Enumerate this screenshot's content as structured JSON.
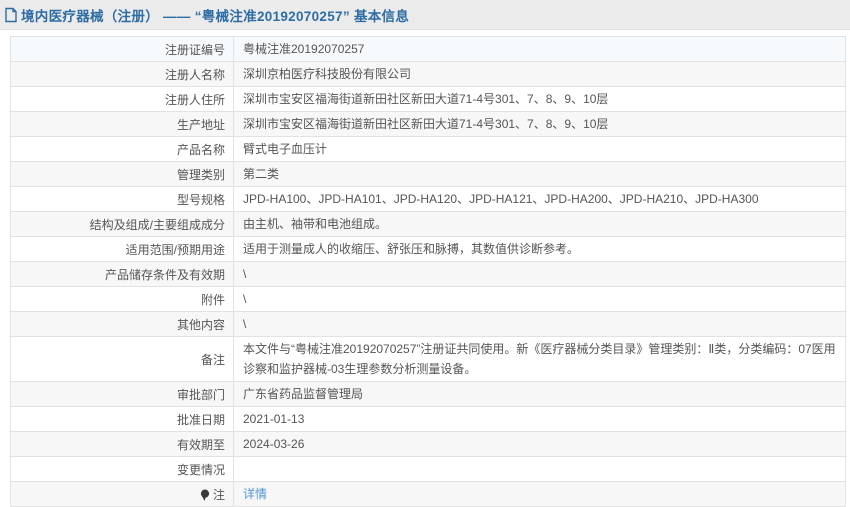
{
  "header": {
    "title": "境内医疗器械（注册） —— “粤械注准20192070257” 基本信息",
    "icon": "document-icon"
  },
  "colors": {
    "accent_blue": "#2e6da4",
    "link_blue": "#4f96d8",
    "header_bg": "#ebebeb",
    "row_alt_bg": "#f7f7f7",
    "first_row_bg": "#f7fafd",
    "border": "#e2e2e2",
    "text": "#555555"
  },
  "table": {
    "rows": [
      {
        "label": "注册证编号",
        "value": "粤械注准20192070257"
      },
      {
        "label": "注册人名称",
        "value": "深圳京柏医疗科技股份有限公司"
      },
      {
        "label": "注册人住所",
        "value": "深圳市宝安区福海街道新田社区新田大道71-4号301、7、8、9、10层"
      },
      {
        "label": "生产地址",
        "value": "深圳市宝安区福海街道新田社区新田大道71-4号301、7、8、9、10层"
      },
      {
        "label": "产品名称",
        "value": "臂式电子血压计"
      },
      {
        "label": "管理类别",
        "value": "第二类"
      },
      {
        "label": "型号规格",
        "value": "JPD-HA100、JPD-HA101、JPD-HA120、JPD-HA121、JPD-HA200、JPD-HA210、JPD-HA300"
      },
      {
        "label": "结构及组成/主要组成成分",
        "value": "由主机、袖带和电池组成。"
      },
      {
        "label": "适用范围/预期用途",
        "value": "适用于测量成人的收缩压、舒张压和脉搏，其数值供诊断参考。"
      },
      {
        "label": "产品储存条件及有效期",
        "value": "\\"
      },
      {
        "label": "附件",
        "value": "\\"
      },
      {
        "label": "其他内容",
        "value": "\\"
      },
      {
        "label": "备注",
        "value": "本文件与“粤械注准20192070257”注册证共同使用。新《医疗器械分类目录》管理类别：Ⅱ类，分类编码：07医用诊察和监护器械-03生理参数分析测量设备。",
        "multiline": true
      },
      {
        "label": "审批部门",
        "value": "广东省药品监督管理局"
      },
      {
        "label": "批准日期",
        "value": "2021-01-13"
      },
      {
        "label": "有效期至",
        "value": "2024-03-26"
      },
      {
        "label": "变更情况",
        "value": ""
      },
      {
        "label": "注",
        "label_icon": "pin-icon",
        "value": "详情",
        "value_type": "link"
      }
    ]
  }
}
